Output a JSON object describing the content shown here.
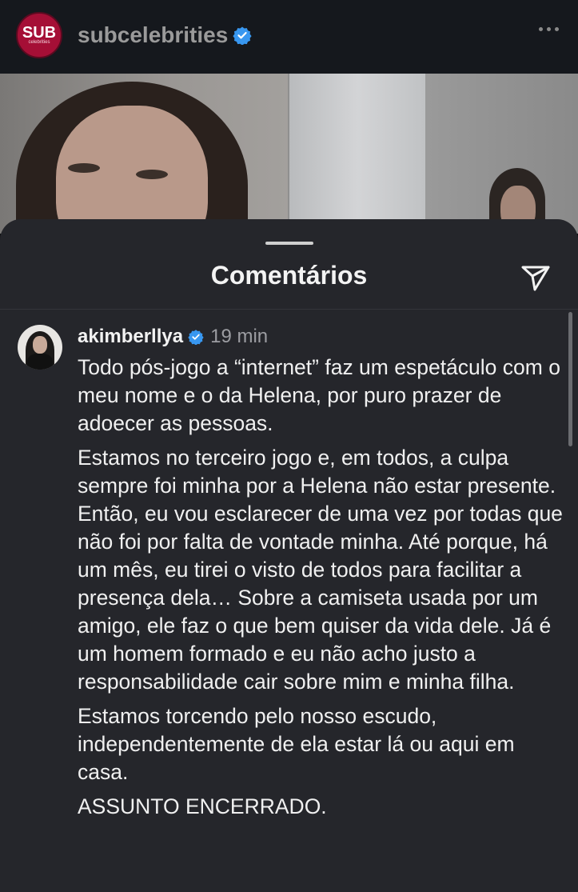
{
  "header": {
    "avatar_text": "SUB",
    "avatar_subtext": "celebrities",
    "username": "subcelebrities"
  },
  "sheet": {
    "title": "Comentários"
  },
  "comment": {
    "username": "akimberllya",
    "time": "19 min",
    "paragraphs": [
      "Todo pós-jogo a “internet” faz um espetáculo com o meu nome e o da Helena, por puro prazer de adoecer as pessoas.",
      "Estamos no terceiro jogo e, em todos, a culpa sempre foi minha por a Helena não estar presente. Então, eu vou esclarecer de uma vez por todas que não foi por falta de vontade minha. Até porque, há um mês, eu tirei o visto de todos para facilitar a presença dela… Sobre a camiseta usada por um amigo, ele faz o que bem quiser da vida dele. Já é um homem formado e eu não acho justo a responsabilidade cair sobre mim e minha filha.",
      "Estamos torcendo pelo nosso escudo, independentemente de ela estar lá ou aqui em casa.",
      "ASSUNTO ENCERRADO."
    ]
  },
  "colors": {
    "verified": "#3897f0",
    "sheet_bg": "#25262b",
    "header_bg": "#15181d",
    "brand_red": "#a50f36"
  },
  "icons": {
    "more": "more-horizontal-icon",
    "send": "paper-plane-icon",
    "verified": "verified-badge-icon"
  }
}
